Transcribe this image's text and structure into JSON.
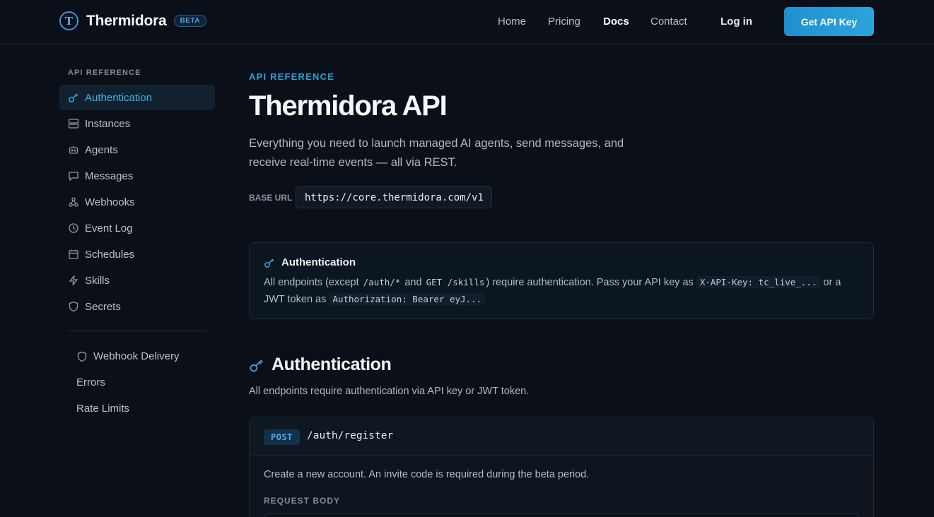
{
  "header": {
    "brand_letter": "T",
    "brand_name": "Thermidora",
    "badge": "BETA",
    "nav": [
      "Home",
      "Pricing",
      "Docs",
      "Contact"
    ],
    "active_nav": "Docs",
    "login": "Log in",
    "cta": "Get API Key"
  },
  "sidebar": {
    "section_label": "API REFERENCE",
    "items": [
      {
        "label": "Authentication",
        "icon": "key-icon",
        "active": true
      },
      {
        "label": "Instances",
        "icon": "server-icon",
        "active": false
      },
      {
        "label": "Agents",
        "icon": "robot-icon",
        "active": false
      },
      {
        "label": "Messages",
        "icon": "chat-icon",
        "active": false
      },
      {
        "label": "Webhooks",
        "icon": "webhook-icon",
        "active": false
      },
      {
        "label": "Event Log",
        "icon": "clock-icon",
        "active": false
      },
      {
        "label": "Schedules",
        "icon": "calendar-icon",
        "active": false
      },
      {
        "label": "Skills",
        "icon": "lightning-icon",
        "active": false
      },
      {
        "label": "Secrets",
        "icon": "shield-icon",
        "active": false
      }
    ],
    "sub_items": [
      {
        "label": "Webhook Delivery",
        "icon": "shield-icon"
      },
      {
        "label": "Errors"
      },
      {
        "label": "Rate Limits"
      }
    ]
  },
  "main": {
    "eyebrow": "API REFERENCE",
    "title": "Thermidora API",
    "lead": "Everything you need to launch managed AI agents, send messages, and receive real-time events — all via REST.",
    "base_url_label": "BASE URL",
    "base_url": "https://core.thermidora.com/v1",
    "auth_card": {
      "title": "Authentication",
      "text_1": "All endpoints (except",
      "code_1": "/auth/*",
      "text_2": "and",
      "code_2": "GET /skills",
      "text_3": ") require authentication. Pass your API key as",
      "code_3": "X-API-Key: tc_live_...",
      "text_4": "or a JWT token as",
      "code_4": "Authorization: Bearer eyJ..."
    },
    "section": {
      "title": "Authentication",
      "description": "All endpoints require authentication via API key or JWT token."
    },
    "endpoint": {
      "method": "POST",
      "path": "/auth/register",
      "description": "Create a new account. An invite code is required during the beta period.",
      "request_body_label": "REQUEST BODY"
    }
  },
  "colors": {
    "accent": "#2ba4dc",
    "background": "#0b1018"
  }
}
